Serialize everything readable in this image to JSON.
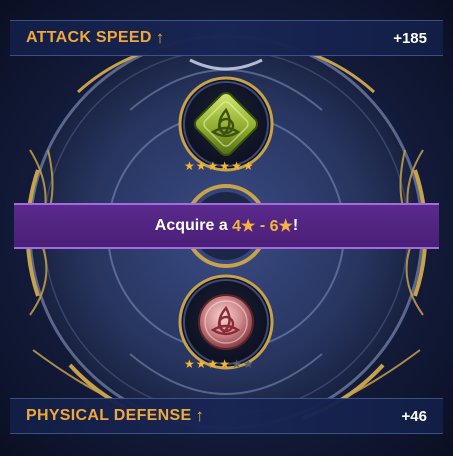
{
  "top_stat": {
    "name": "ATTACK SPEED",
    "value": "+185",
    "arrow": "↑"
  },
  "bottom_stat": {
    "name": "PHYSICAL DEFENSE",
    "value": "+46",
    "arrow": "↑"
  },
  "banner": {
    "prefix": "Acquire a ",
    "range_low": "4★",
    "separator": " - ",
    "range_high": "6★",
    "suffix": "!"
  },
  "top_item": {
    "icon": "green-triquetra-gem-icon",
    "stars_filled": 6,
    "stars_total": 6
  },
  "bottom_item": {
    "icon": "red-triquetra-gem-icon",
    "stars_filled": 4,
    "stars_total": 6
  },
  "colors": {
    "accent": "#f0a83a",
    "banner": "#4a1f78",
    "gold": "#c8a24a",
    "star_on": "#f5b830",
    "star_off": "#5a6070"
  }
}
